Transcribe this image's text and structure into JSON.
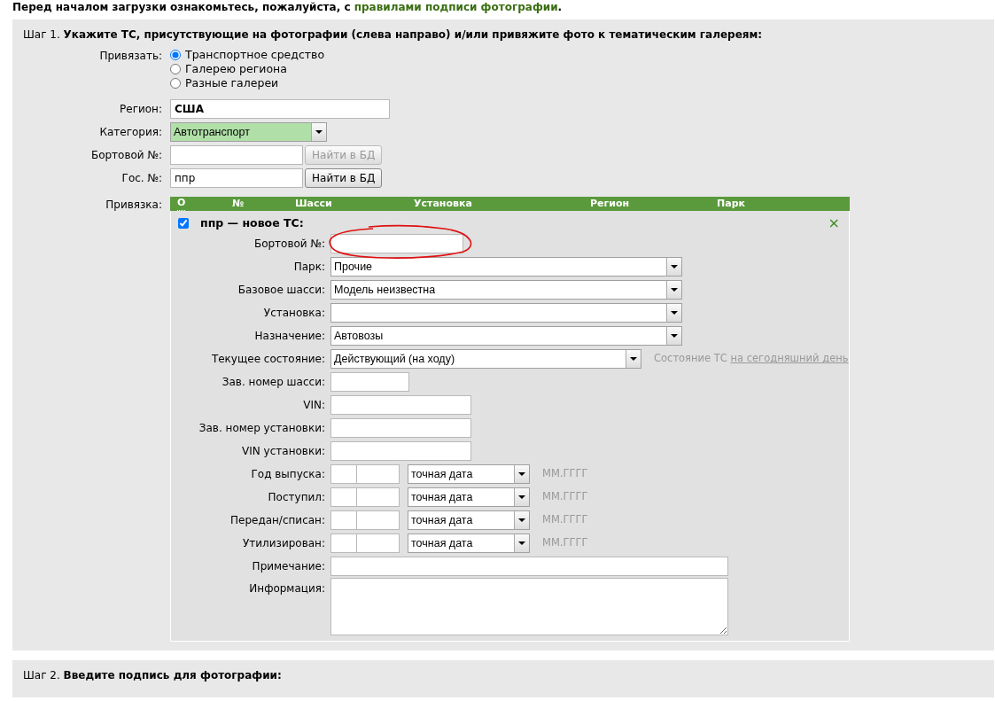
{
  "notice": {
    "text": "Перед началом загрузки ознакомьтесь, пожалуйста, с ",
    "link": "правилами подписи фотографии",
    "end": "."
  },
  "step1": {
    "prefix": "Шаг 1.",
    "title": "Укажите ТС, присутствующие на фотографии (слева направо) и/или привяжите фото к тематическим галереям:"
  },
  "bind": {
    "label": "Привязать:",
    "options": [
      {
        "label": "Транспортное средство",
        "selected": true
      },
      {
        "label": "Галерею региона",
        "selected": false
      },
      {
        "label": "Разные галереи",
        "selected": false
      }
    ]
  },
  "region": {
    "label": "Регион:",
    "value": "США"
  },
  "category": {
    "label": "Категория:",
    "value": "Автотранспорт"
  },
  "lookups": [
    {
      "label": "Бортовой №:",
      "button": "Найти в БД",
      "disabled": true
    },
    {
      "label": "Гос. №:",
      "value": "ппр",
      "button": "Найти в БД",
      "disabled": false
    }
  ],
  "links": {
    "label": "Привязка:",
    "columns": [
      "О",
      "№",
      "Шасси",
      "Установка",
      "Регион",
      "Парк"
    ],
    "vehicle": {
      "checked": true,
      "title": "ппр — новое ТС:",
      "close": "×",
      "fields": [
        {
          "kind": "input",
          "label": "Бортовой №:",
          "annotated": true
        },
        {
          "kind": "select",
          "label": "Парк:",
          "value": "Прочие"
        },
        {
          "kind": "select",
          "label": "Базовое шасси:",
          "value": "Модель неизвестна"
        },
        {
          "kind": "select",
          "label": "Установка:"
        },
        {
          "kind": "select",
          "label": "Назначение:",
          "value": "Автовозы"
        },
        {
          "kind": "status",
          "label": "Текущее состояние:",
          "value": "Действующий (на ходу)",
          "hint": "Состояние ТС ",
          "hint_link": "на сегодняшний день"
        },
        {
          "kind": "code",
          "label": "Зав. номер шасси:"
        },
        {
          "kind": "input",
          "label": "VIN:"
        },
        {
          "kind": "input",
          "label": "Зав. номер установки:"
        },
        {
          "kind": "input",
          "label": "VIN установки:"
        },
        {
          "kind": "date",
          "label": "Год выпуска:",
          "value": "точная дата",
          "hint": "ММ.ГГГГ"
        },
        {
          "kind": "date",
          "label": "Поступил:",
          "value": "точная дата",
          "hint": "ММ.ГГГГ"
        },
        {
          "kind": "date",
          "label": "Передан/списан:",
          "value": "точная дата",
          "hint": "ММ.ГГГГ"
        },
        {
          "kind": "date",
          "label": "Утилизирован:",
          "value": "точная дата",
          "hint": "ММ.ГГГГ"
        },
        {
          "kind": "note",
          "label": "Примечание:"
        },
        {
          "kind": "textarea",
          "label": "Информация:"
        }
      ]
    }
  },
  "step2": {
    "prefix": "Шаг 2.",
    "title": "Введите подпись для фотографии:"
  }
}
